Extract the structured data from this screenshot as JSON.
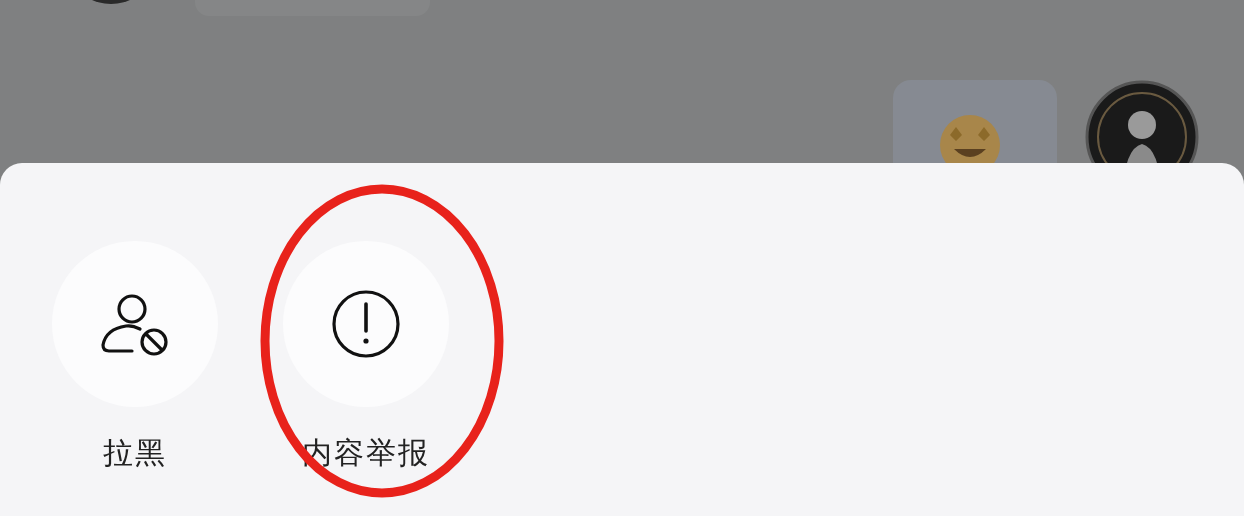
{
  "action_sheet": {
    "actions": [
      {
        "kind": "block",
        "label": "拉黑",
        "highlighted": false
      },
      {
        "kind": "report",
        "label": "内容举报",
        "highlighted": true
      }
    ]
  }
}
